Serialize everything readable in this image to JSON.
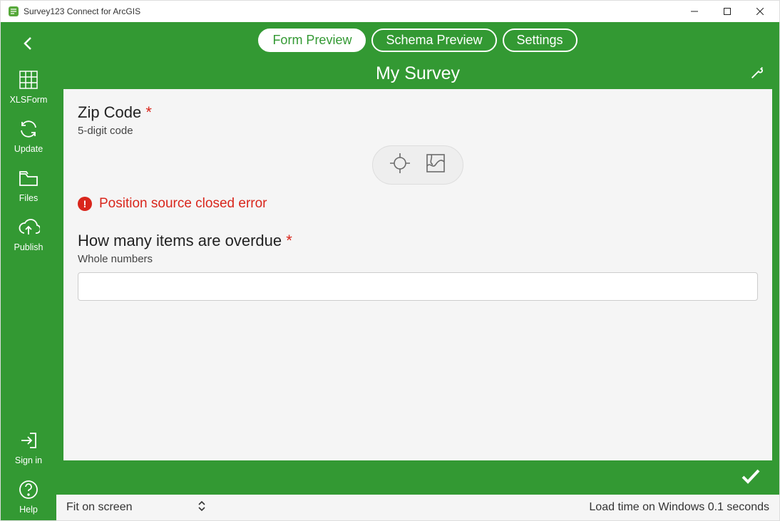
{
  "window": {
    "title": "Survey123 Connect for ArcGIS"
  },
  "sidebar": {
    "items": [
      {
        "label": "XLSForm"
      },
      {
        "label": "Update"
      },
      {
        "label": "Files"
      },
      {
        "label": "Publish"
      }
    ],
    "bottom": [
      {
        "label": "Sign in"
      },
      {
        "label": "Help"
      }
    ]
  },
  "tabs": {
    "form_preview": "Form Preview",
    "schema_preview": "Schema Preview",
    "settings": "Settings"
  },
  "survey": {
    "title": "My Survey",
    "q1_label": "Zip Code",
    "q1_hint": "5-digit code",
    "error_text": "Position source closed error",
    "q2_label": "How many items are overdue",
    "q2_hint": "Whole numbers",
    "q2_value": ""
  },
  "status": {
    "fit": "Fit on screen",
    "load": "Load time on Windows 0.1 seconds"
  }
}
